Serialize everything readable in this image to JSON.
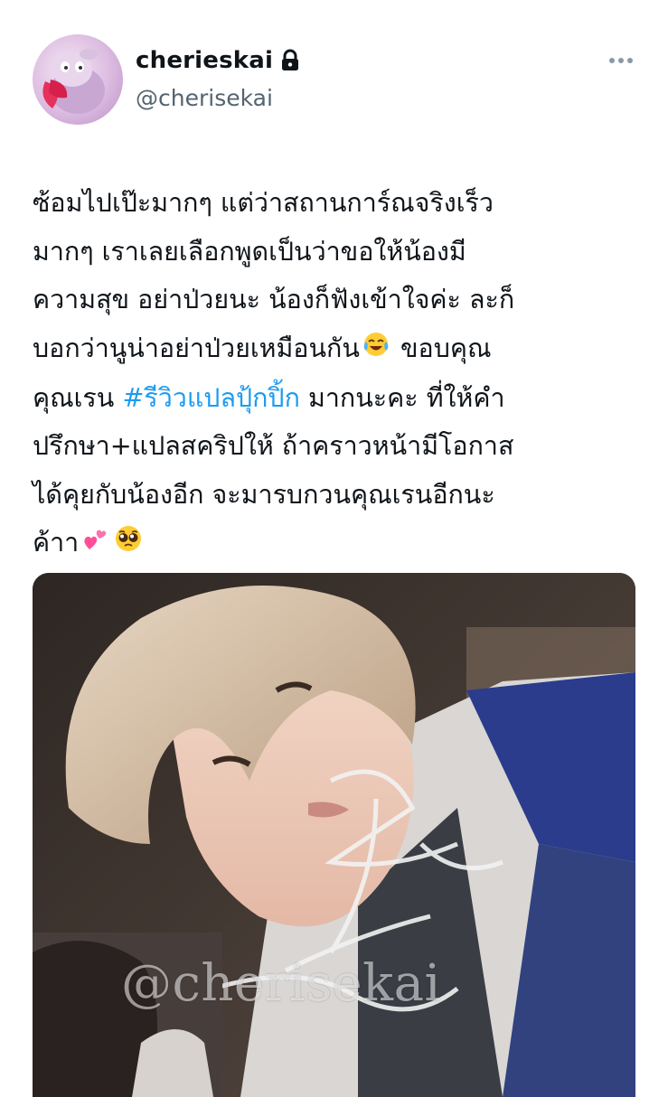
{
  "author": {
    "display_name": "cherieskai",
    "handle": "@cherisekai"
  },
  "tweet": {
    "lines": [
      "ซ้อมไปเป๊ะมากๆ แต่ว่าสถานการ์ณจริงเร็ว",
      "มากๆ เราเลยเลือกพูดเป็นว่าขอให้น้องมี",
      "ความสุข อย่าป่วยนะ น้องก็ฟังเข้าใจค่ะ ละก็",
      "บอกว่านูน่าอย่าป่วยเหมือนกัน",
      " ขอบคุณ",
      "คุณเรน ",
      "#รีวิวแปลปุ้กปิ้ก",
      " มากนะคะ ที่ให้คำ",
      "ปรึกษา+แปลสคริปให้ ถ้าคราวหน้ามีโอกาส",
      "ได้คุยกับน้องอีก จะมารบกวนคุณเรนอีกนะ",
      "ค้าา"
    ],
    "emojis": [
      "face-with-tears-of-joy",
      "two-hearts",
      "pleading-face"
    ]
  },
  "media": {
    "watermark": "@cherisekai"
  },
  "icons": {
    "lock": "lock-icon",
    "more": "more-icon"
  },
  "colors": {
    "hashtag": "#1d9bf0",
    "handle": "#536471",
    "text": "#0f1419"
  }
}
